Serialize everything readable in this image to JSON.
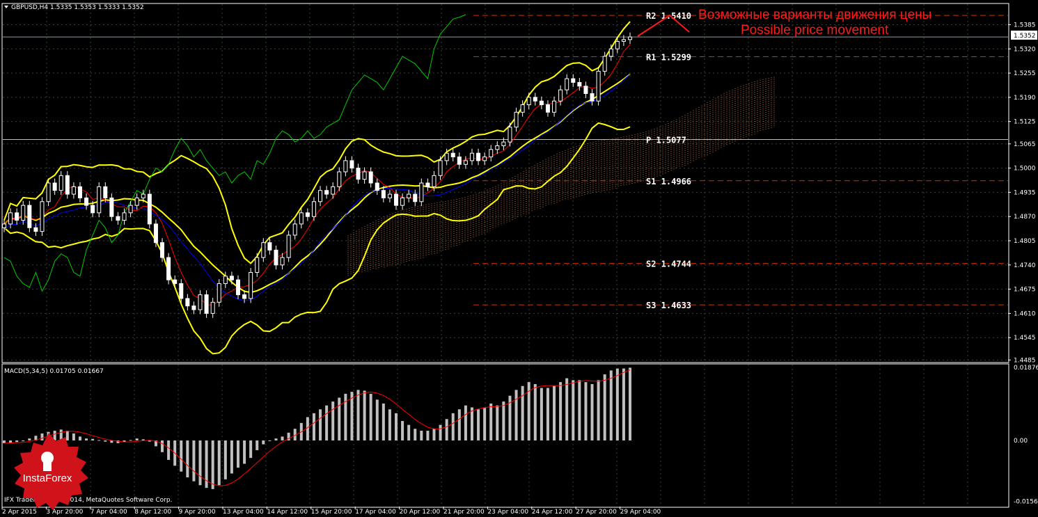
{
  "chart_data": {
    "type": "candlestick",
    "symbol_header": "GBPUSD,H4  1.5335 1.5353 1.5333 1.5352",
    "last_price": "1.5352",
    "price_axis_ticks": [
      "1.5385",
      "1.5320",
      "1.5255",
      "1.5190",
      "1.5125",
      "1.5065",
      "1.5000",
      "1.4935",
      "1.4870",
      "1.4805",
      "1.4740",
      "1.4675",
      "1.4610",
      "1.4545",
      "1.4485"
    ],
    "price_range": [
      1.448,
      1.544
    ],
    "time_labels": [
      "2 Apr 2015",
      "3 Apr 20:00",
      "7 Apr 04:00",
      "8 Apr 12:00",
      "9 Apr 20:00",
      "13 Apr 04:00",
      "14 Apr 12:00",
      "15 Apr 20:00",
      "17 Apr 04:00",
      "20 Apr 12:00",
      "21 Apr 20:00",
      "23 Apr 04:00",
      "24 Apr 12:00",
      "27 Apr 20:00",
      "29 Apr 04:00"
    ],
    "pivots": [
      {
        "name": "R2",
        "value": 1.541,
        "label": "R2  1.5410"
      },
      {
        "name": "R1",
        "value": 1.5299,
        "label": "R1  1.5299"
      },
      {
        "name": "P",
        "value": 1.5077,
        "label": "P  1.5077"
      },
      {
        "name": "S1",
        "value": 1.4966,
        "label": "S1  1.4966"
      },
      {
        "name": "S2",
        "value": 1.4744,
        "label": "S2  1.4744"
      },
      {
        "name": "S3",
        "value": 1.4633,
        "label": "S3  1.4633"
      }
    ],
    "closes": [
      1.485,
      1.488,
      1.486,
      1.49,
      1.484,
      1.483,
      1.491,
      1.496,
      1.494,
      1.498,
      1.493,
      1.495,
      1.492,
      1.49,
      1.488,
      1.495,
      1.492,
      1.487,
      1.486,
      1.488,
      1.49,
      1.492,
      1.493,
      1.485,
      1.48,
      1.476,
      1.47,
      1.469,
      1.465,
      1.463,
      1.462,
      1.466,
      1.461,
      1.464,
      1.469,
      1.471,
      1.47,
      1.466,
      1.465,
      1.472,
      1.476,
      1.48,
      1.478,
      1.474,
      1.476,
      1.482,
      1.485,
      1.488,
      1.487,
      1.491,
      1.494,
      1.493,
      1.495,
      1.499,
      1.502,
      1.5,
      1.497,
      1.499,
      1.496,
      1.494,
      1.492,
      1.493,
      1.49,
      1.492,
      1.493,
      1.491,
      1.496,
      1.495,
      1.498,
      1.502,
      1.504,
      1.503,
      1.501,
      1.502,
      1.504,
      1.502,
      1.503,
      1.505,
      1.506,
      1.507,
      1.511,
      1.515,
      1.517,
      1.519,
      1.518,
      1.517,
      1.515,
      1.518,
      1.521,
      1.524,
      1.523,
      1.522,
      1.52,
      1.518,
      1.526,
      1.53,
      1.532,
      1.534,
      1.5345,
      1.5352
    ],
    "macd_header": "MACD(5,34,5) 0.01705 0.01667",
    "macd_axis_ticks": [
      "0.01876",
      "0.00",
      "-0.01565"
    ],
    "macd_range": [
      -0.017,
      0.0195
    ],
    "macd_hist": [
      -0.0007,
      -0.0006,
      -0.0004,
      -0.0002,
      0.0005,
      0.0012,
      0.0018,
      0.0022,
      0.0025,
      0.0028,
      0.0025,
      0.0018,
      0.001,
      0.0005,
      0.0004,
      0.0001,
      -0.0003,
      -0.0006,
      -0.0007,
      -0.0004,
      0.0001,
      0.0005,
      0.0003,
      -0.0003,
      -0.0015,
      -0.003,
      -0.005,
      -0.0065,
      -0.008,
      -0.0095,
      -0.0105,
      -0.0115,
      -0.0122,
      -0.0125,
      -0.0115,
      -0.01,
      -0.0085,
      -0.007,
      -0.006,
      -0.0045,
      -0.0025,
      -0.001,
      0.0,
      0.0005,
      0.001,
      0.002,
      0.003,
      0.0045,
      0.006,
      0.007,
      0.008,
      0.009,
      0.01,
      0.011,
      0.012,
      0.0125,
      0.013,
      0.0128,
      0.012,
      0.0105,
      0.0095,
      0.008,
      0.007,
      0.005,
      0.004,
      0.003,
      0.0025,
      0.0025,
      0.003,
      0.004,
      0.0055,
      0.007,
      0.008,
      0.009,
      0.0085,
      0.008,
      0.0085,
      0.0095,
      0.009,
      0.01,
      0.0115,
      0.013,
      0.014,
      0.015,
      0.0145,
      0.0135,
      0.0135,
      0.014,
      0.015,
      0.016,
      0.0155,
      0.0155,
      0.015,
      0.0145,
      0.0155,
      0.017,
      0.018,
      0.0185,
      0.0185,
      0.0187
    ],
    "annotation_ru": "Возможные варианты движения цены",
    "annotation_en": "Possible price movement",
    "copyright": "IFX Trader, © 2001-2014, MetaQuotes Software Corp.",
    "colors": {
      "bull": "#ffffff",
      "bear": "#ffffff",
      "bands": "#ffff00",
      "tenkan": "#ff0000",
      "kijun": "#0000ff",
      "chikou": "#00cc00",
      "pivot": "#cc3300",
      "macd_hist": "#c0c0c0",
      "macd_signal": "#ff0000",
      "annotation": "#ff1a1a"
    },
    "logo_text": "InstaForex"
  }
}
